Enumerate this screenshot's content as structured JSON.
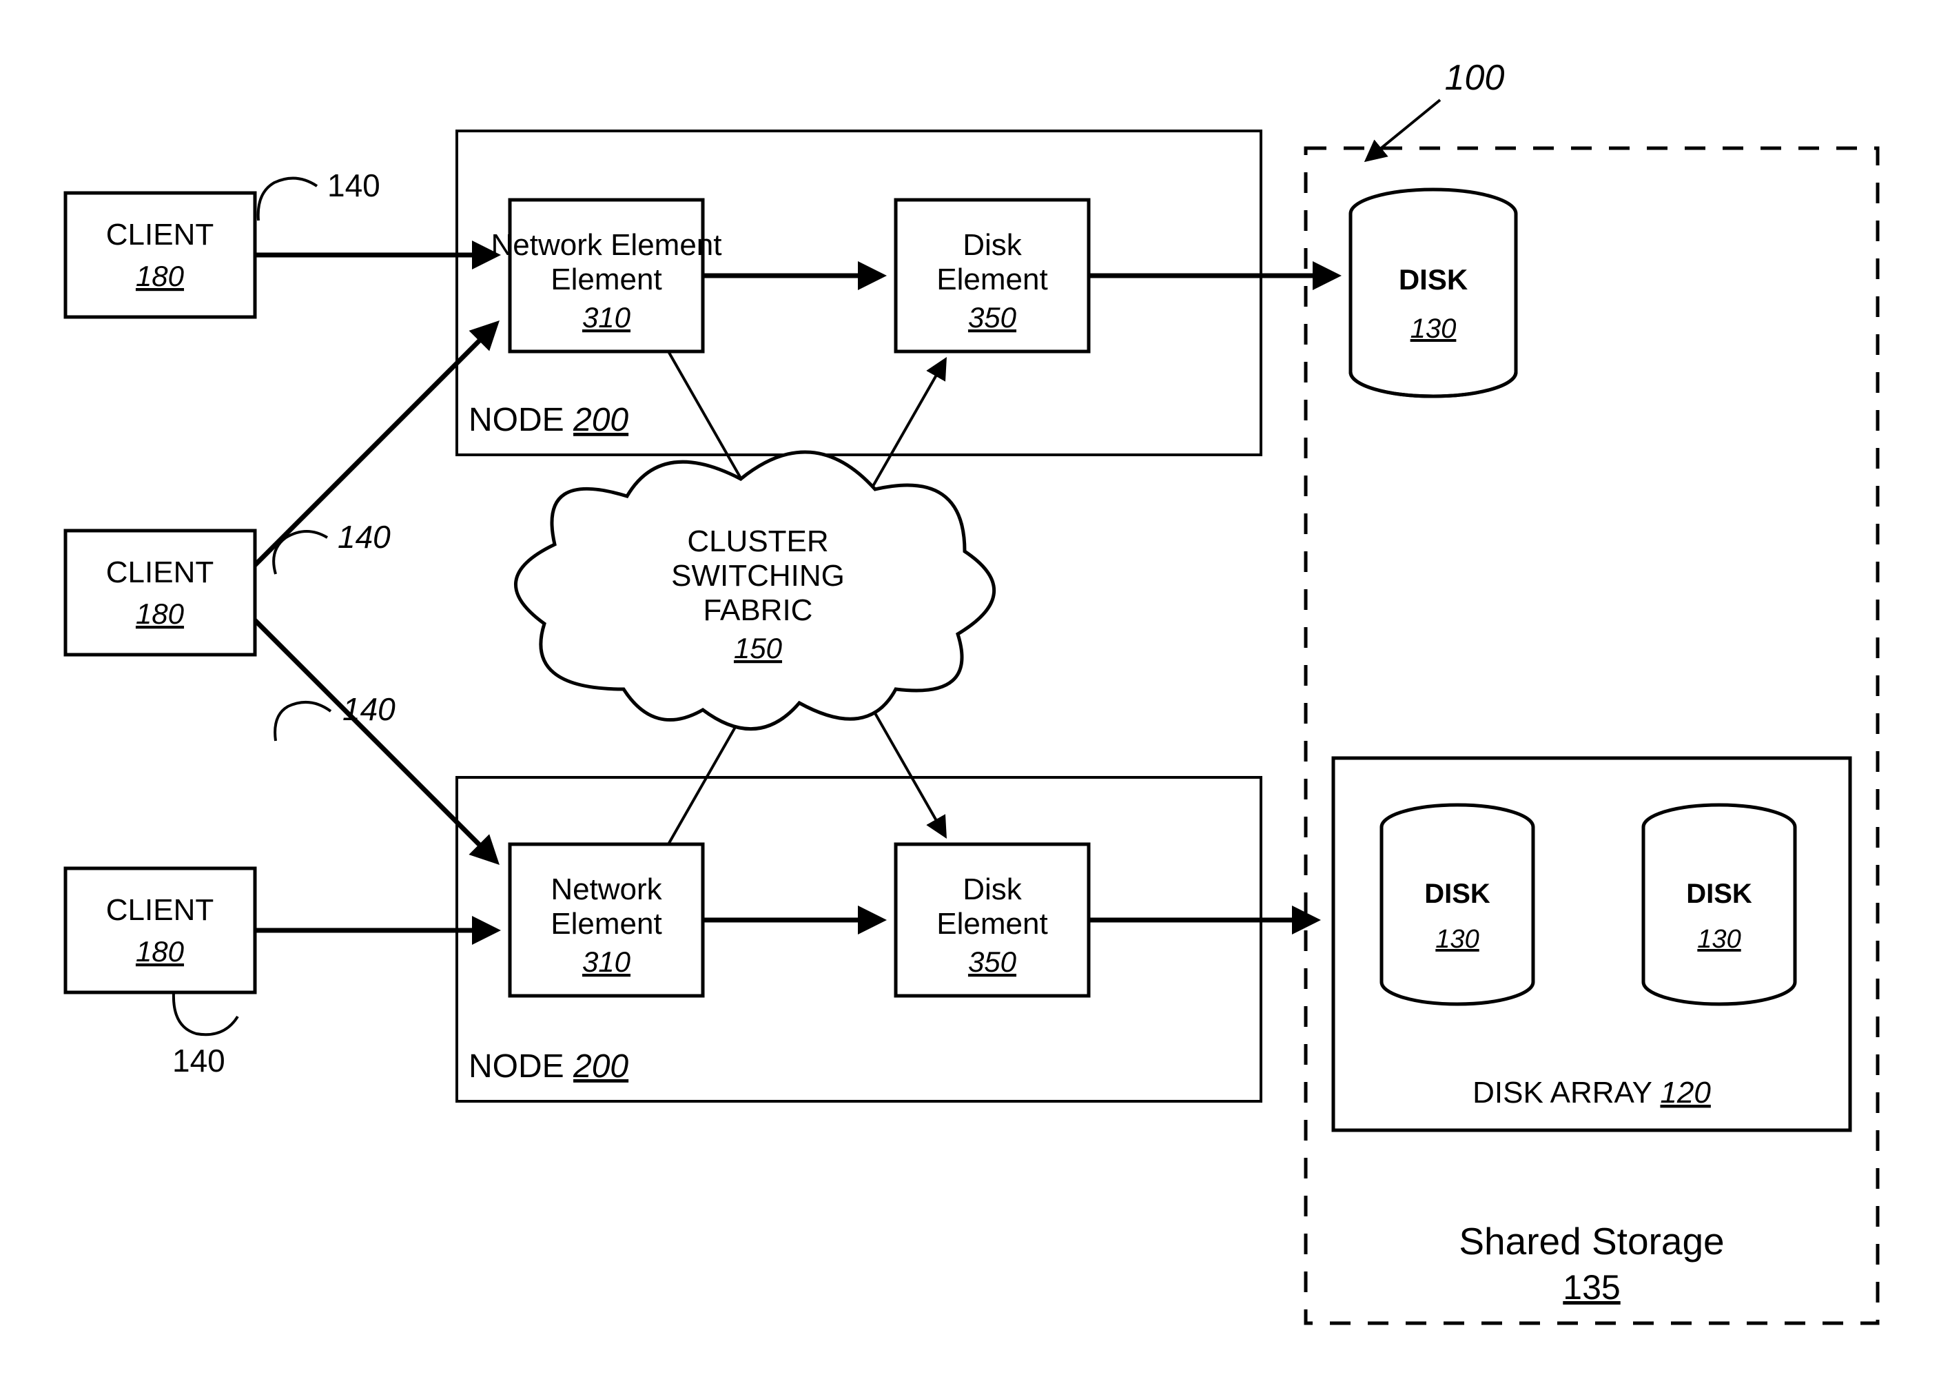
{
  "figure_ref": "100",
  "clients": [
    {
      "label": "CLIENT",
      "ref": "180"
    },
    {
      "label": "CLIENT",
      "ref": "180"
    },
    {
      "label": "CLIENT",
      "ref": "180"
    }
  ],
  "connection_refs": [
    "140",
    "140",
    "140",
    "140"
  ],
  "nodes": [
    {
      "label": "NODE",
      "ref": "200",
      "network_element": {
        "label": "Network Element",
        "ref": "310"
      },
      "disk_element": {
        "label": "Disk Element",
        "ref": "350"
      }
    },
    {
      "label": "NODE",
      "ref": "200",
      "network_element": {
        "label": "Network Element",
        "ref": "310"
      },
      "disk_element": {
        "label": "Disk Element",
        "ref": "350"
      }
    }
  ],
  "fabric": {
    "line1": "CLUSTER",
    "line2": "SWITCHING",
    "line3": "FABRIC",
    "ref": "150"
  },
  "shared_storage": {
    "label": "Shared Storage",
    "ref": "135"
  },
  "disks": [
    {
      "label": "DISK",
      "ref": "130"
    },
    {
      "label": "DISK",
      "ref": "130"
    },
    {
      "label": "DISK",
      "ref": "130"
    }
  ],
  "disk_array": {
    "label": "DISK ARRAY",
    "ref": "120"
  }
}
